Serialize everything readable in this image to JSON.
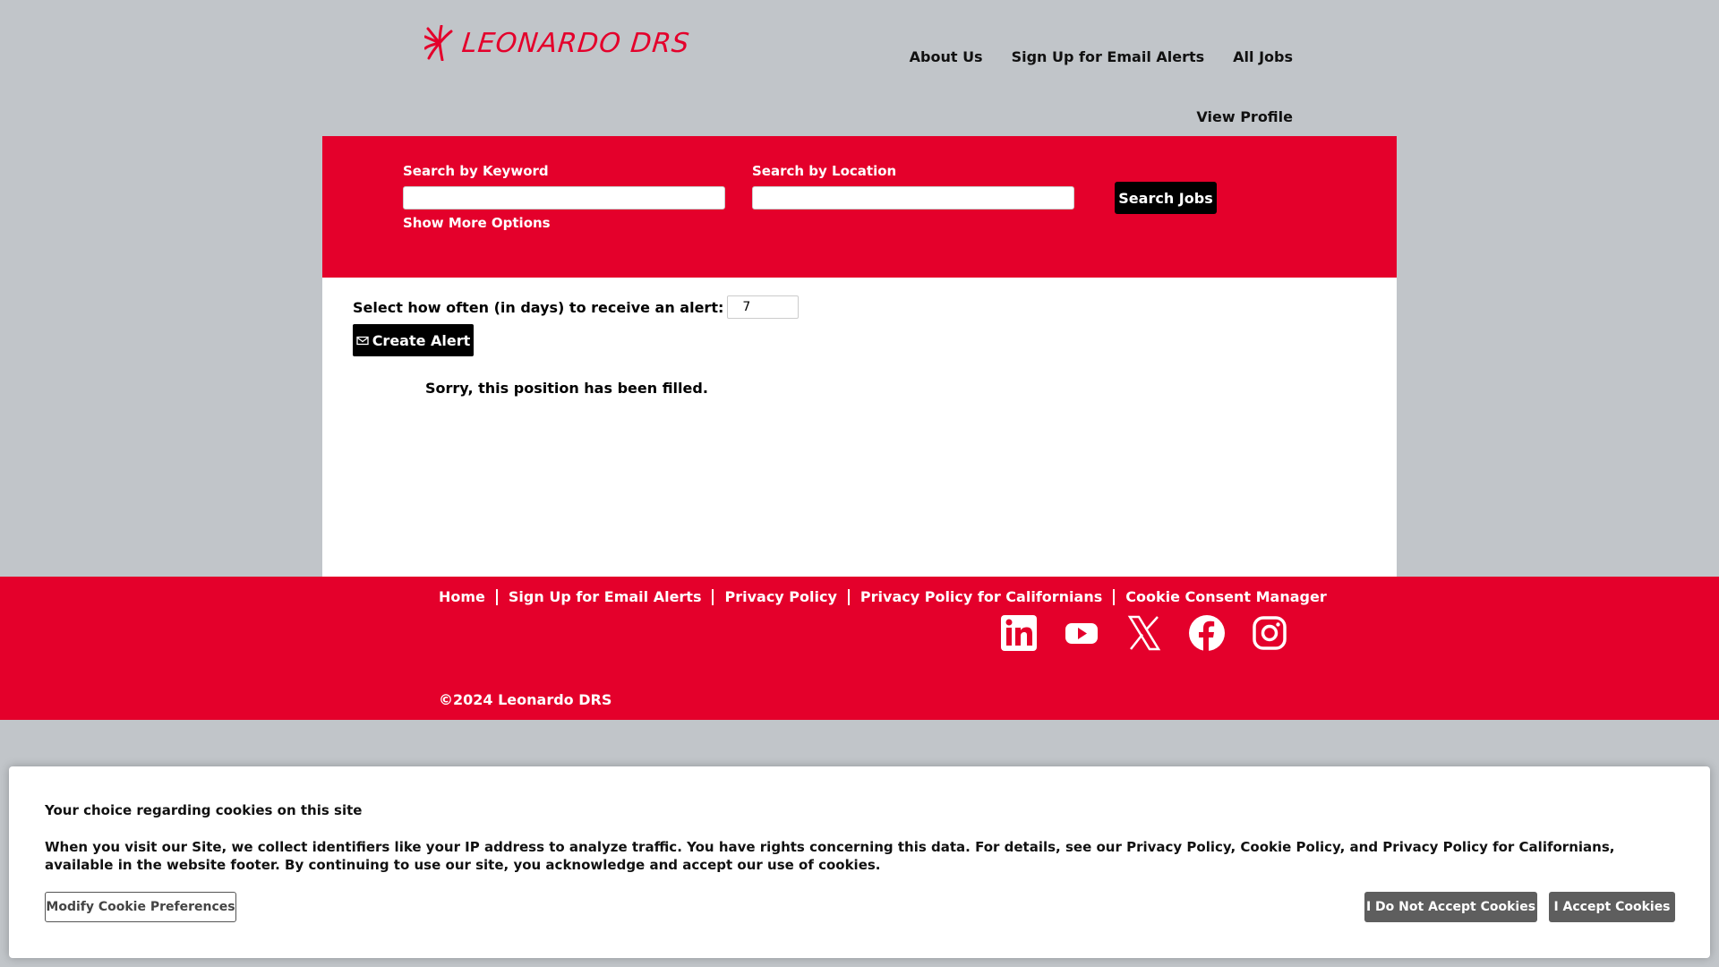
{
  "header": {
    "logo_text": "LEONARDO DRS",
    "nav": [
      "About Us",
      "Sign Up for Email Alerts",
      "All Jobs"
    ],
    "view_profile": "View Profile"
  },
  "search": {
    "keyword_label": "Search by Keyword",
    "keyword_value": "",
    "location_label": "Search by Location",
    "location_value": "",
    "button_label": "Search Jobs",
    "more_options": "Show More Options"
  },
  "alert": {
    "label": "Select how often (in days) to receive an alert:",
    "value": "7",
    "button_label": "Create Alert",
    "button_icon": "envelope-icon"
  },
  "message": "Sorry, this position has been filled.",
  "footer": {
    "links": [
      "Home",
      "Sign Up for Email Alerts",
      "Privacy Policy",
      "Privacy Policy for Californians",
      "Cookie Consent Manager"
    ],
    "social_icons": [
      "linkedin-icon",
      "youtube-icon",
      "x-icon",
      "facebook-icon",
      "instagram-icon"
    ],
    "copyright": "©2024 Leonardo DRS"
  },
  "cookie_banner": {
    "title": "Your choice regarding cookies on this site",
    "body": "When you visit our Site, we collect identifiers like your IP address to analyze traffic. You have rights concerning this data. For details, see our Privacy Policy, Cookie Policy, and Privacy Policy for Californians, available in the website footer. By continuing to use our site, you acknowledge and accept our use of cookies.",
    "modify_label": "Modify Cookie Preferences",
    "reject_label": "I Do Not Accept Cookies",
    "accept_label": "I Accept Cookies"
  },
  "colors": {
    "brand_red": "#e4002b",
    "page_bg": "#c1c5c9",
    "button_dark": "#000000",
    "cookie_button": "#5e5e5e"
  }
}
